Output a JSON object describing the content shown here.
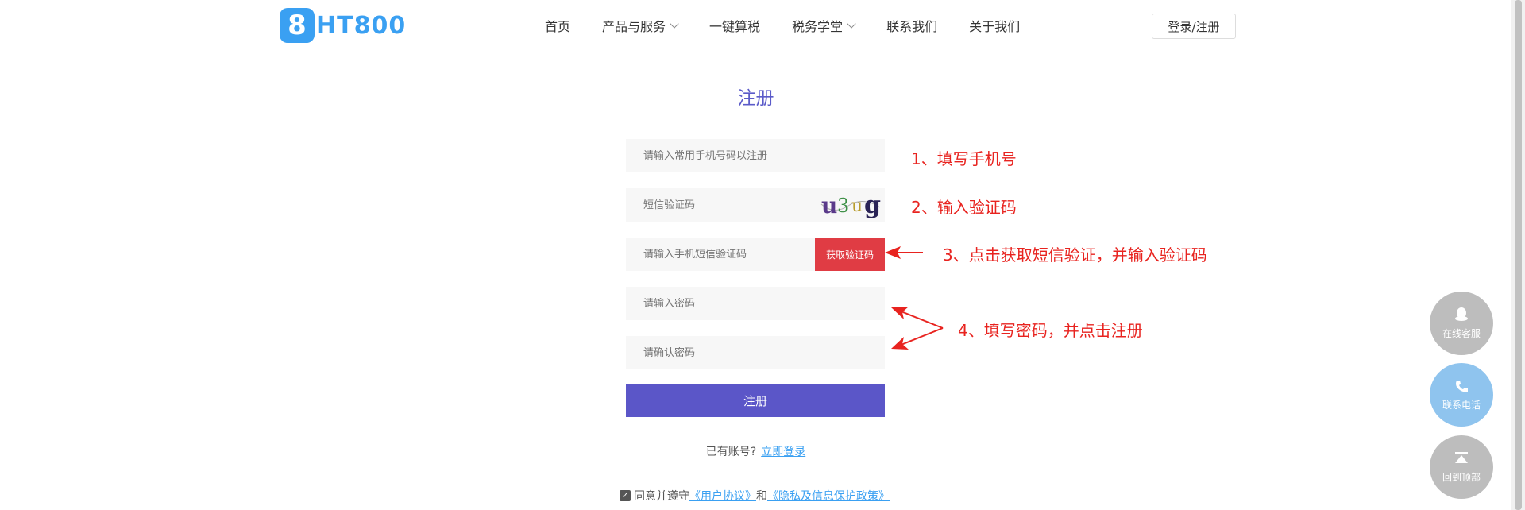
{
  "header": {
    "logo_mark": "8",
    "logo_text": "HT800",
    "nav": [
      {
        "label": "首页",
        "dropdown": false
      },
      {
        "label": "产品与服务",
        "dropdown": true
      },
      {
        "label": "一键算税",
        "dropdown": false
      },
      {
        "label": "税务学堂",
        "dropdown": true
      },
      {
        "label": "联系我们",
        "dropdown": false
      },
      {
        "label": "关于我们",
        "dropdown": false
      }
    ],
    "login_label": "登录/注册"
  },
  "form": {
    "title": "注册",
    "phone_placeholder": "请输入常用手机号码以注册",
    "captcha_placeholder": "短信验证码",
    "captcha_text": "u3ug",
    "sms_placeholder": "请输入手机短信验证码",
    "get_code_label": "获取验证码",
    "password_placeholder": "请输入密码",
    "confirm_placeholder": "请确认密码",
    "submit_label": "注册",
    "has_account_text": "已有账号?",
    "login_link": "立即登录",
    "agree_text": "同意并遵守",
    "user_agreement": "《用户协议》",
    "and_text": "和",
    "privacy_policy": "《隐私及信息保护政策》"
  },
  "annotations": {
    "step1": "1、填写手机号",
    "step2": "2、输入验证码",
    "step3": "3、点击获取短信验证，并输入验证码",
    "step4": "4、填写密码，并点击注册"
  },
  "float_buttons": {
    "service": "在线客服",
    "phone": "联系电话",
    "top": "回到顶部"
  },
  "colors": {
    "brand": "#3aa0f2",
    "primary": "#5b56c8",
    "danger": "#e03c44",
    "annotation": "#e8231f"
  }
}
